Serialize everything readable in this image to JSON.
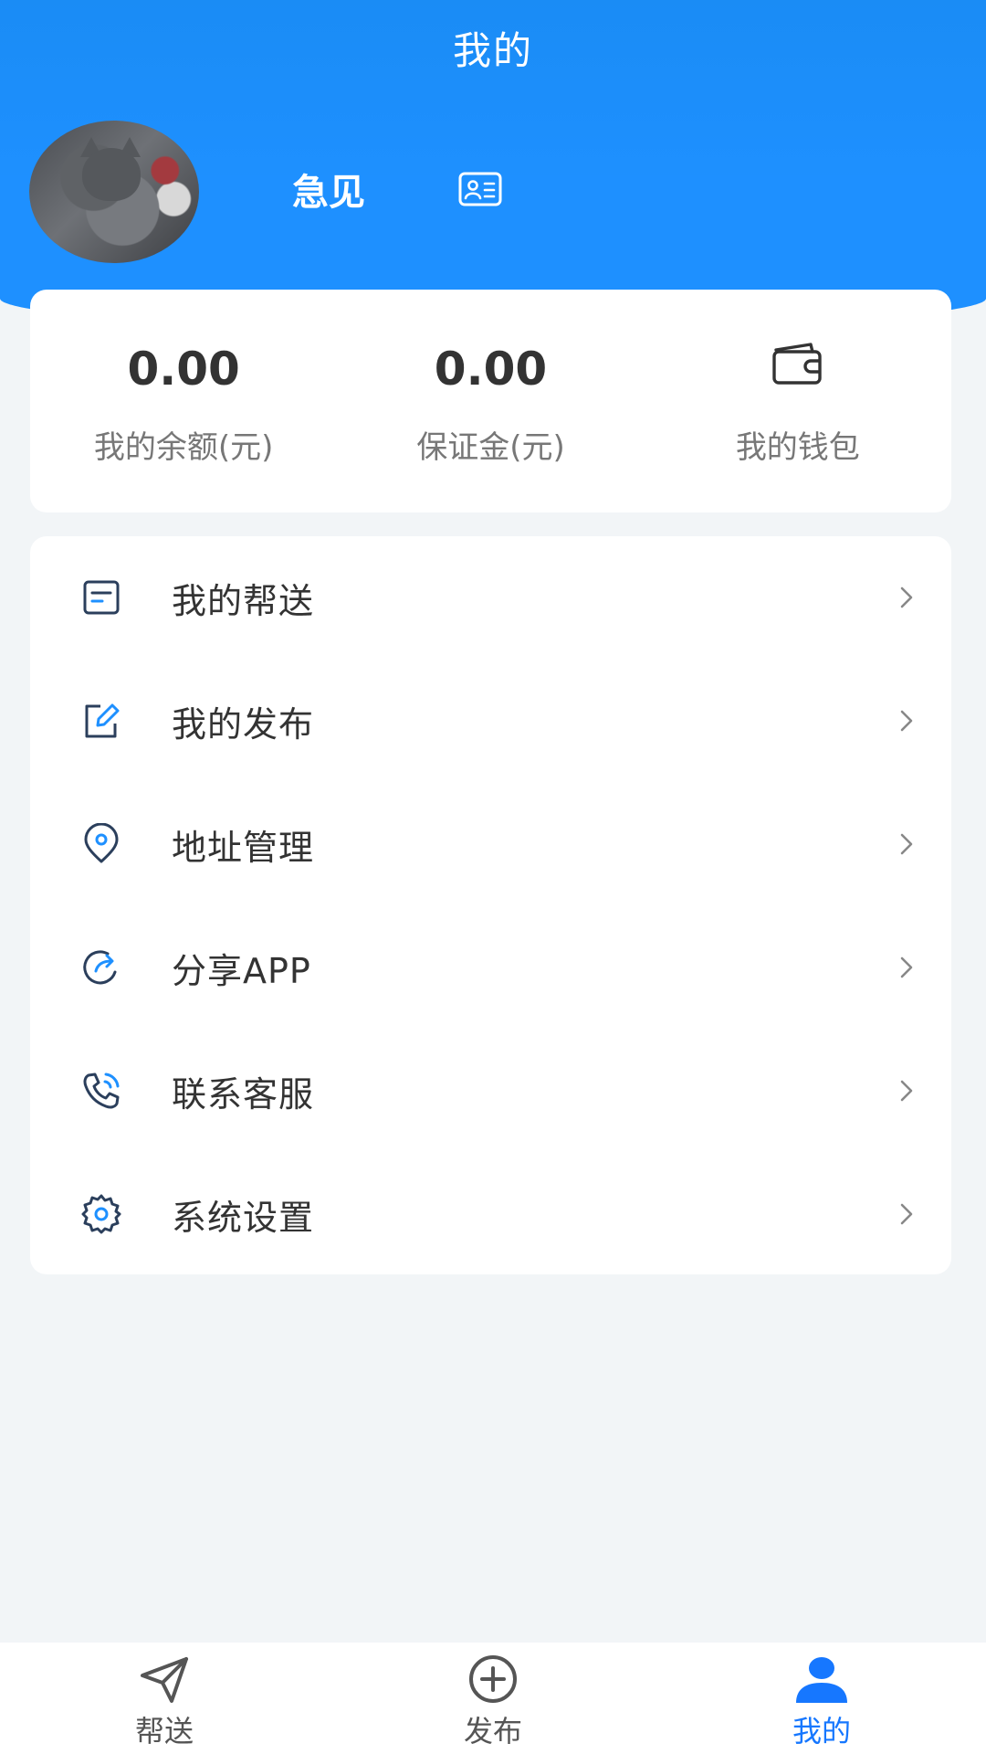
{
  "header": {
    "title": "我的"
  },
  "profile": {
    "name": "急见",
    "avatar_icon": "user-avatar-photo",
    "id_card_icon": "id-card-icon"
  },
  "stats": {
    "balance_value": "0.00",
    "balance_label": "我的余额(元)",
    "deposit_value": "0.00",
    "deposit_label": "保证金(元)",
    "wallet_label": "我的钱包"
  },
  "menu": {
    "items": [
      {
        "label": "我的帮送",
        "icon": "document-icon"
      },
      {
        "label": "我的发布",
        "icon": "edit-icon"
      },
      {
        "label": "地址管理",
        "icon": "location-icon"
      },
      {
        "label": "分享APP",
        "icon": "share-icon"
      },
      {
        "label": "联系客服",
        "icon": "phone-icon"
      },
      {
        "label": "系统设置",
        "icon": "gear-icon"
      }
    ]
  },
  "tabbar": {
    "items": [
      {
        "label": "帮送",
        "icon": "send-icon",
        "active": false
      },
      {
        "label": "发布",
        "icon": "plus-circle-icon",
        "active": false
      },
      {
        "label": "我的",
        "icon": "user-icon",
        "active": true
      }
    ]
  },
  "colors": {
    "primary": "#1e90ff",
    "active_tab": "#1677ff",
    "background": "#f2f5f7",
    "icon_stroke": "#2b3f5c"
  }
}
